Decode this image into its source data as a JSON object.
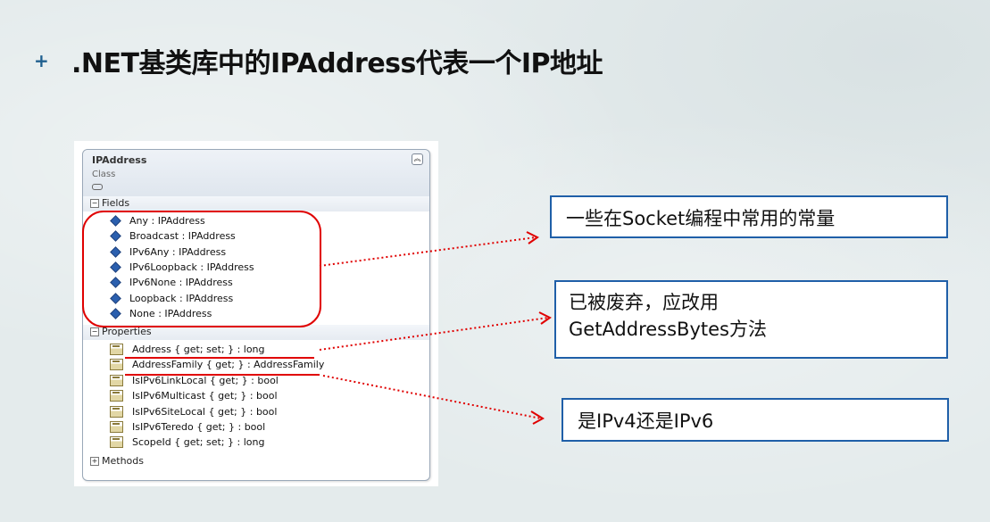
{
  "title": {
    "bullet": "+",
    "text": ".NET基类库中的IPAddress代表一个IP地址"
  },
  "class_diagram": {
    "name": "IPAddress",
    "kind": "Class",
    "collapse_icon": "double-chevron-up-icon",
    "fields_section": "Fields",
    "fields": [
      "Any : IPAddress",
      "Broadcast : IPAddress",
      "IPv6Any : IPAddress",
      "IPv6Loopback : IPAddress",
      "IPv6None : IPAddress",
      "Loopback : IPAddress",
      "None : IPAddress"
    ],
    "properties_section": "Properties",
    "properties": [
      "Address { get; set; } : long",
      "AddressFamily { get; } : AddressFamily",
      "IsIPv6LinkLocal { get; } : bool",
      "IsIPv6Multicast { get; } : bool",
      "IsIPv6SiteLocal { get; } : bool",
      "IsIPv6Teredo { get; } : bool",
      "ScopeId { get; set; } : long"
    ],
    "methods_section": "Methods",
    "expanded_toggle": "⊟",
    "collapsed_toggle": "⊞"
  },
  "callouts": {
    "constants": "一些在Socket编程中常用的常量",
    "obsolete_line1": "已被废弃，应改用",
    "obsolete_line2": "GetAddressBytes方法",
    "family": "是IPv4还是IPv6"
  },
  "colors": {
    "highlight_red": "#e00000",
    "callout_border": "#1f5fa8",
    "bullet": "#1f5f8f"
  }
}
